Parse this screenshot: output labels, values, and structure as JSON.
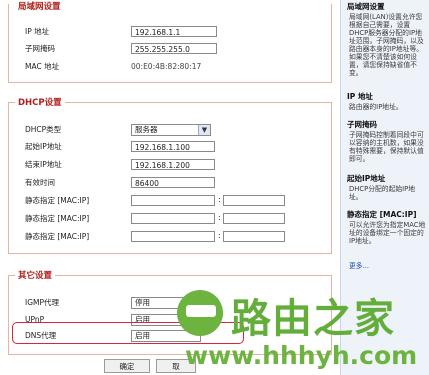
{
  "lan": {
    "title": "局域网设置",
    "ip_label": "IP 地址",
    "ip_value": "192.168.1.1",
    "mask_label": "子网掩码",
    "mask_value": "255.255.255.0",
    "mac_label": "MAC 地址",
    "mac_value": "00:E0:4B:82:80:17"
  },
  "dhcp": {
    "title": "DHCP设置",
    "type_label": "DHCP类型",
    "type_value": "服务器",
    "start_label": "起始IP地址",
    "start_value": "192.168.1.100",
    "end_label": "结束IP地址",
    "end_value": "192.168.1.200",
    "lease_label": "有效时间",
    "lease_value": "86400",
    "static_rows": [
      {
        "label": "静态指定 [MAC:IP]",
        "mac": "",
        "ip": ""
      },
      {
        "label": "静态指定 [MAC:IP]",
        "mac": "",
        "ip": ""
      },
      {
        "label": "静态指定 [MAC:IP]",
        "mac": "",
        "ip": ""
      }
    ]
  },
  "other": {
    "title": "其它设置",
    "igmp_label": "IGMP代理",
    "igmp_value": "停用",
    "upnp_label": "UPnP",
    "upnp_value": "启用",
    "dns_label": "DNS代理",
    "dns_value": "启用"
  },
  "buttons": {
    "ok": "确定",
    "cancel": "取"
  },
  "sidebar": {
    "lan_title": "局域网设置",
    "lan_text": "局域网(LAN)设置允许您根据自己需要，设置DHCP服务器分配的IP地址范围，子网掩码，以及路由器本身的IP地址等。如果您不清楚该如何设置，请您保持缺省值不变。",
    "ip_title": "IP 地址",
    "ip_text": "路由器的IP地址。",
    "mask_title": "子网掩码",
    "mask_text": "子网掩码控制着同段中可以容纳的主机数，如果没有特殊需要，保持默认值即可。",
    "start_title": "起始IP地址",
    "start_text": "DHCP分配的起始IP地址。",
    "static_title": "静态指定 [MAC:IP]",
    "static_text": "可以允许您为指定MAC地址的设备绑定一个固定的IP地址。",
    "more": "更多..."
  },
  "watermark": {
    "brand": "路由之家",
    "url": "www.hhhyh.com"
  },
  "colors": {
    "legend_red": "#b0201c",
    "panel_border": "#e3b6a4",
    "sidebar_bg": "#eef3fa",
    "highlight_red": "#d8263a",
    "logo_green": "#63ad3b"
  }
}
